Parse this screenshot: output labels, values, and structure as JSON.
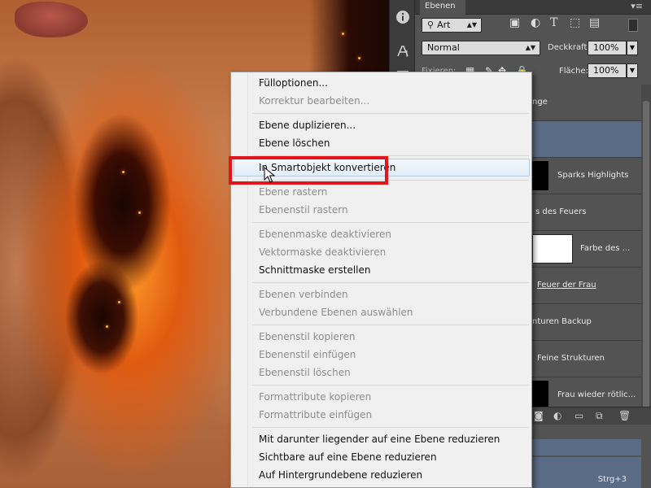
{
  "layers_panel": {
    "tab_label": "Ebenen",
    "panel_menu_icon": "panel-menu-icon",
    "filter": {
      "icon": "search-icon",
      "value": "Art"
    },
    "blend_mode": "Normal",
    "opacity_label": "Deckkraft:",
    "opacity_value": "100%",
    "lock_label": "Fixieren:",
    "fill_label": "Fläche:",
    "fill_value": "100%",
    "layers": [
      {
        "name": "nge"
      },
      {
        "name": ""
      },
      {
        "name": "Sparks Highlights"
      },
      {
        "name": "s des Feuers"
      },
      {
        "name": "Farbe des ..."
      },
      {
        "name": "Feuer der Frau"
      },
      {
        "name": "nturen Backup"
      },
      {
        "name": "Feine Strukturen"
      },
      {
        "name": "Frau wieder rötlic..."
      }
    ],
    "lower_shortcut": "Strg+3"
  },
  "context_menu": {
    "items": [
      {
        "label": "Fülloptionen...",
        "enabled": true
      },
      {
        "label": "Korrektur bearbeiten...",
        "enabled": false
      },
      {
        "label": "Ebene duplizieren...",
        "enabled": true
      },
      {
        "label": "Ebene löschen",
        "enabled": true
      },
      {
        "label": "In Smartobjekt konvertieren",
        "enabled": true,
        "highlighted": true
      },
      {
        "label": "Ebene rastern",
        "enabled": false
      },
      {
        "label": "Ebenenstil rastern",
        "enabled": false
      },
      {
        "label": "Ebenenmaske deaktivieren",
        "enabled": false
      },
      {
        "label": "Vektormaske deaktivieren",
        "enabled": false
      },
      {
        "label": "Schnittmaske erstellen",
        "enabled": true
      },
      {
        "label": "Ebenen verbinden",
        "enabled": false
      },
      {
        "label": "Verbundene Ebenen auswählen",
        "enabled": false
      },
      {
        "label": "Ebenenstil kopieren",
        "enabled": false
      },
      {
        "label": "Ebenenstil einfügen",
        "enabled": false
      },
      {
        "label": "Ebenenstil löschen",
        "enabled": false
      },
      {
        "label": "Formattribute kopieren",
        "enabled": false
      },
      {
        "label": "Formattribute einfügen",
        "enabled": false
      },
      {
        "label": "Mit darunter liegender auf eine Ebene reduzieren",
        "enabled": true
      },
      {
        "label": "Sichtbare auf eine Ebene reduzieren",
        "enabled": true
      },
      {
        "label": "Auf Hintergrundebene reduzieren",
        "enabled": true
      }
    ]
  },
  "colors": {
    "highlight_box": "#e3141b",
    "selected_layer": "#5a6b85",
    "menu_background": "#f0f0f0"
  }
}
